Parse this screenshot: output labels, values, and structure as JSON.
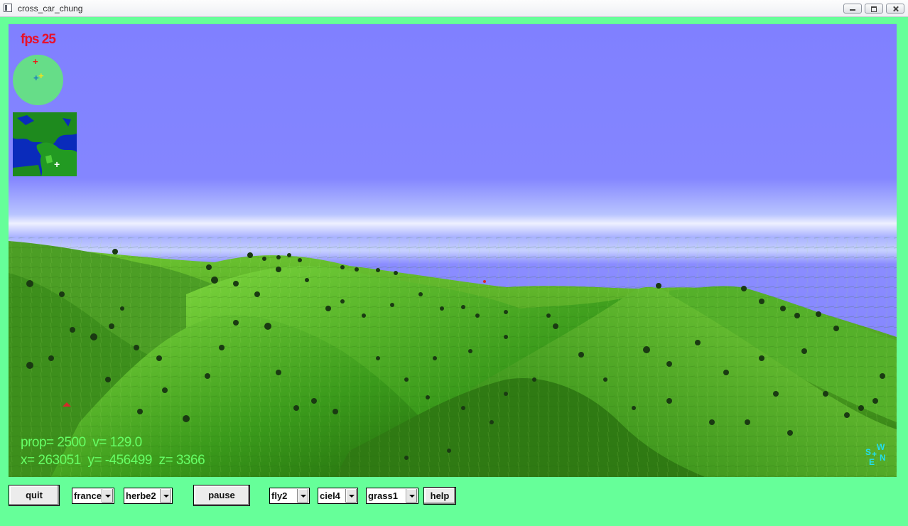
{
  "window": {
    "title": "cross_car_chung"
  },
  "hud": {
    "fps_label": "fps 25",
    "line1": "prop= 2500  v= 129.0",
    "line2": "x= 263051  y= -456499  z= 3366"
  },
  "compass": {
    "s": "S",
    "w": "W",
    "e": "E",
    "n": "N"
  },
  "controls": {
    "quit": "quit",
    "region": "france",
    "terrain": "herbe2",
    "pause": "pause",
    "mode": "fly2",
    "sky": "ciel4",
    "ground": "grass1",
    "help": "help"
  },
  "colors": {
    "frame": "#66ff99",
    "sky": "#8080ff",
    "fps": "#e8102a",
    "hud_text": "#66ff66",
    "compass": "#22ddee"
  }
}
